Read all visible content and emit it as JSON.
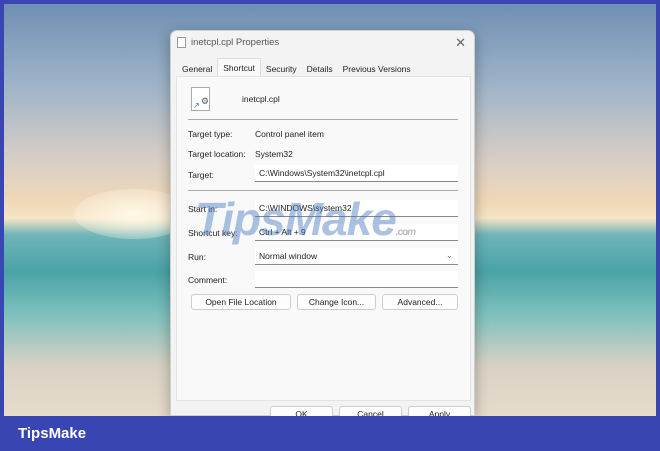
{
  "window": {
    "title": "inetcpl.cpl Properties",
    "close": "✕"
  },
  "tabs": [
    "General",
    "Shortcut",
    "Security",
    "Details",
    "Previous Versions"
  ],
  "file": {
    "name": "inetcpl.cpl"
  },
  "fields": {
    "target_type_label": "Target type:",
    "target_type": "Control panel item",
    "target_location_label": "Target location:",
    "target_location": "System32",
    "target_label": "Target:",
    "target": "C:\\Windows\\System32\\inetcpl.cpl",
    "start_in_label": "Start in:",
    "start_in": "C:\\WINDOWS\\system32",
    "shortcut_key_label": "Shortcut key:",
    "shortcut_key": "Ctrl + Alt + 9",
    "run_label": "Run:",
    "run": "Normal window",
    "comment_label": "Comment:",
    "comment": ""
  },
  "buttons": {
    "open_file_location": "Open File Location",
    "change_icon": "Change Icon...",
    "advanced": "Advanced...",
    "ok": "OK",
    "cancel": "Cancel",
    "apply": "Apply"
  },
  "watermark": {
    "text": "TipsMake",
    "suffix": ".com"
  },
  "footer": {
    "brand": "TipsMake"
  }
}
